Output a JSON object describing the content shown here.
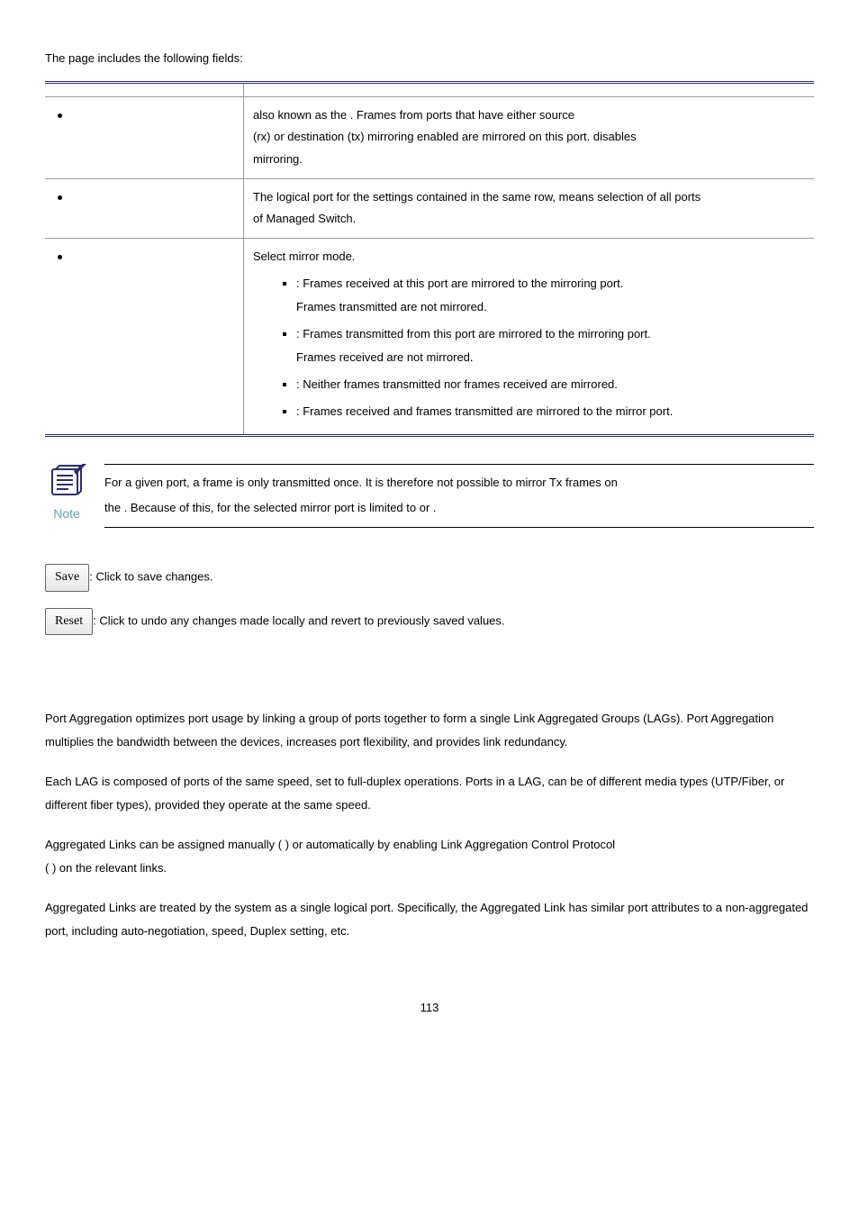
{
  "intro": "The page includes the following fields:",
  "table": {
    "rows": [
      {
        "desc_line1_a": "also known as the ",
        "desc_line1_b": ". Frames from ports that have either source",
        "desc_line2_a": "(rx) or destination (tx) mirroring enabled are mirrored on this port. ",
        "desc_line2_b": " disables",
        "desc_line3": "mirroring."
      },
      {
        "desc_line1": "The logical port for the settings contained in the same row,    means selection of all ports",
        "desc_line2": "of Managed Switch."
      },
      {
        "heading": "Select mirror mode.",
        "items": [
          {
            "suffix": ": Frames received at this port are mirrored to the mirroring port.",
            "cont": "Frames transmitted are not mirrored."
          },
          {
            "suffix": ": Frames transmitted from this port are mirrored to the mirroring port.",
            "cont": "Frames received are not mirrored."
          },
          {
            "suffix": ": Neither frames transmitted nor frames received are mirrored."
          },
          {
            "suffix": ": Frames received and frames transmitted are mirrored to the mirror port."
          }
        ]
      }
    ]
  },
  "note": {
    "label": "Note",
    "line1": "For a given port, a frame is only transmitted once. It is therefore not possible to mirror Tx frames on",
    "line2_a": "the ",
    "line2_b": ". Because of this, ",
    "line2_c": " for the selected mirror port is limited to ",
    "line2_d": " or ",
    "line2_e": "."
  },
  "buttons": {
    "save": "Save",
    "save_desc": ": Click to save changes.",
    "reset": "Reset",
    "reset_desc": ": Click to undo any changes made locally and revert to previously saved values."
  },
  "section": {
    "p1": "Port Aggregation optimizes port usage by linking a group of ports together to form a single Link Aggregated Groups (LAGs). Port Aggregation multiplies the bandwidth between the devices, increases port flexibility, and provides link redundancy.",
    "p2": "Each LAG is composed of ports of the same speed, set to full-duplex operations. Ports in a LAG, can be of different media types (UTP/Fiber, or different fiber types), provided they operate at the same speed.",
    "p3_a": "Aggregated Links can be assigned manually (",
    "p3_b": ") or automatically by enabling Link Aggregation Control Protocol",
    "p3_c": "(",
    "p3_d": ") on the relevant links.",
    "p4": "Aggregated Links are treated by the system as a single logical port. Specifically, the Aggregated Link has similar port attributes to a non-aggregated port, including auto-negotiation, speed, Duplex setting, etc."
  },
  "page_number": "113"
}
